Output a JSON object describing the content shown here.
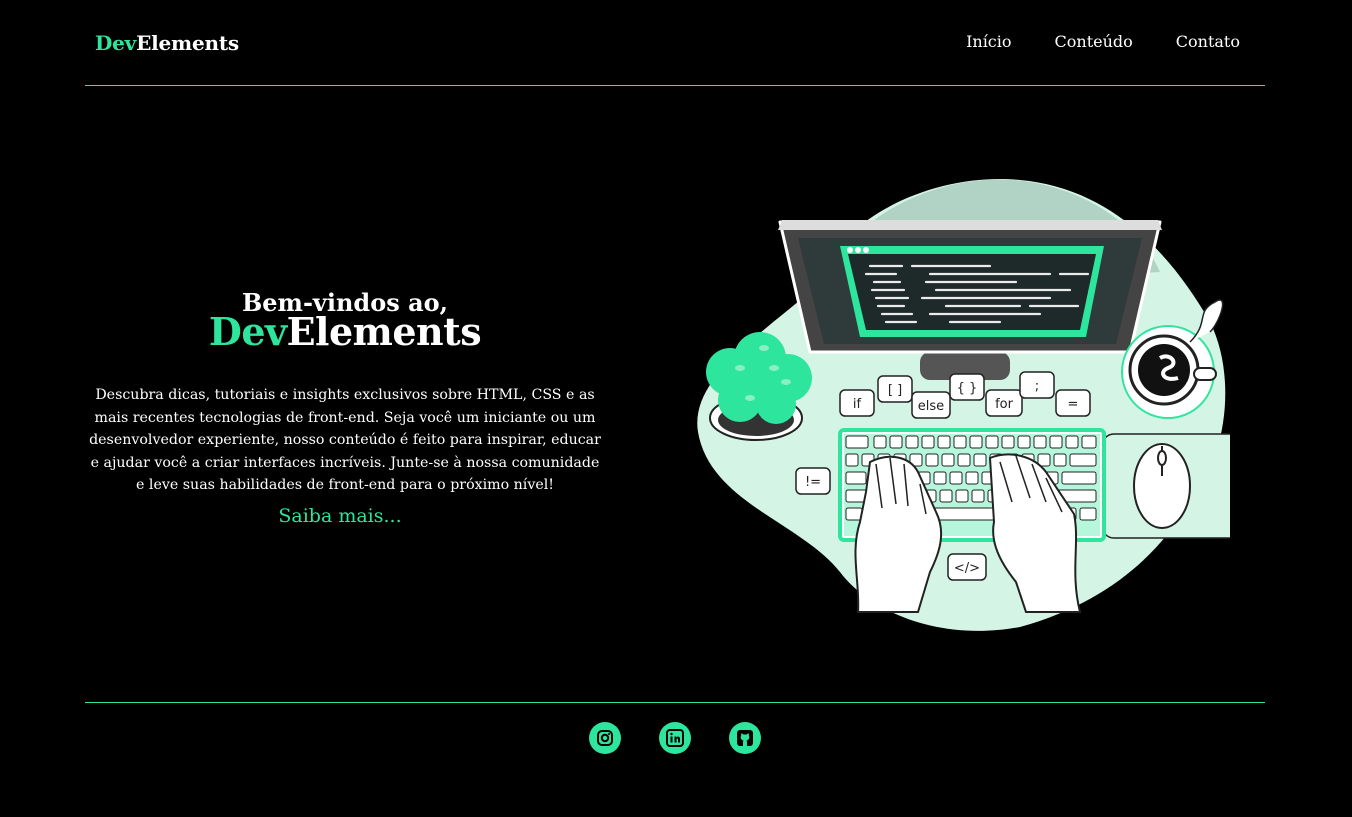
{
  "header": {
    "logo_accent": "Dev",
    "logo_rest": "Elements",
    "nav": [
      {
        "label": "Início"
      },
      {
        "label": "Conteúdo"
      },
      {
        "label": "Contato"
      }
    ]
  },
  "hero": {
    "welcome": "Bem-vindos ao,",
    "brand_accent": "Dev",
    "brand_rest": "Elements",
    "description": "Descubra dicas, tutoriais e insights exclusivos sobre HTML, CSS e as mais recentes tecnologias de front-end. Seja você um iniciante ou um desenvolvedor experiente, nosso conteúdo é feito para inspirar, educar e ajudar você a criar interfaces incríveis. Junte-se à nossa comunidade e leve suas habilidades de front-end para o próximo nível!",
    "cta": "Saiba mais..."
  },
  "illustration": {
    "bubbles": [
      "if",
      "[ ]",
      "else",
      "{ }",
      "for",
      ";",
      "=",
      "!=",
      "</>"
    ]
  },
  "footer": {
    "socials": [
      {
        "icon": "instagram-icon"
      },
      {
        "icon": "linkedin-icon"
      },
      {
        "icon": "github-icon"
      }
    ]
  },
  "colors": {
    "accent": "#2ee59d",
    "background": "#000000",
    "blob": "#d4f5e6"
  }
}
